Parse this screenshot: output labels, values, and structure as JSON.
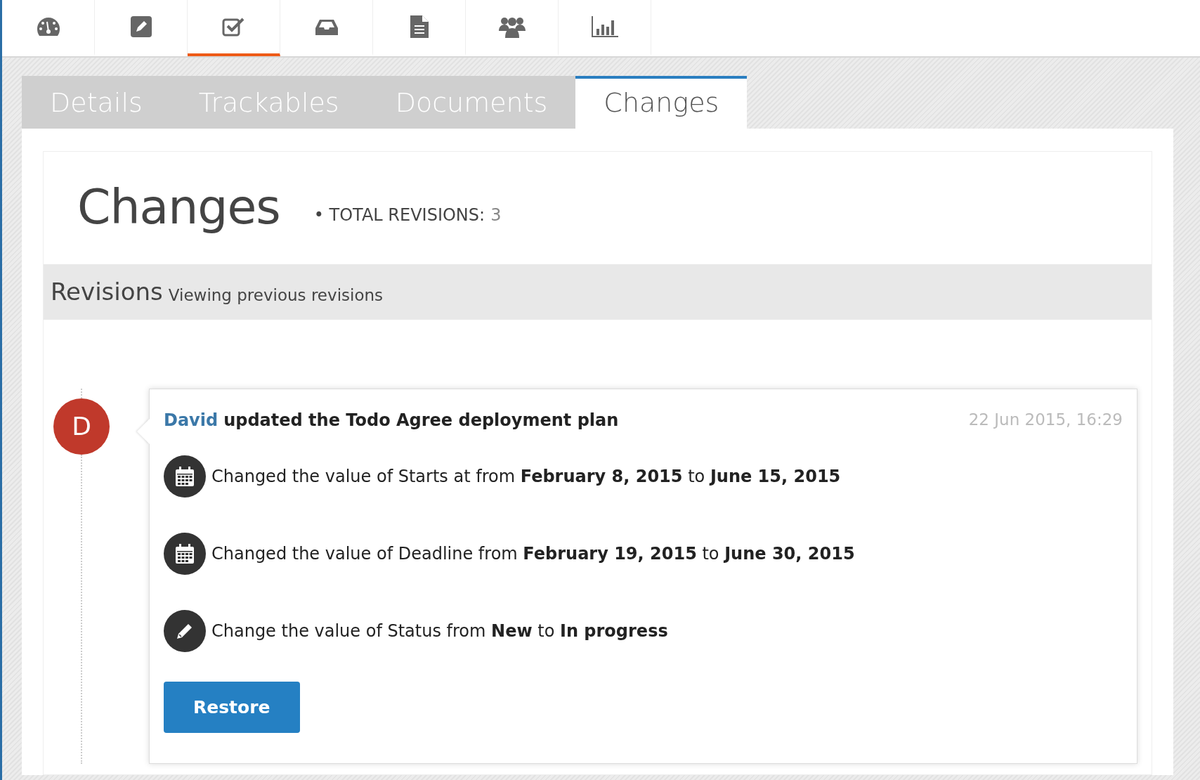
{
  "toolbar": [
    {
      "kind": "dashboard",
      "selected": false
    },
    {
      "kind": "edit",
      "selected": false
    },
    {
      "kind": "check",
      "selected": true
    },
    {
      "kind": "inbox",
      "selected": false
    },
    {
      "kind": "document",
      "selected": false
    },
    {
      "kind": "users",
      "selected": false
    },
    {
      "kind": "chart",
      "selected": false
    }
  ],
  "tabs": [
    {
      "label": "Details",
      "selected": false
    },
    {
      "label": "Trackables",
      "selected": false
    },
    {
      "label": "Documents",
      "selected": false
    },
    {
      "label": "Changes",
      "selected": true
    }
  ],
  "page_title": "Changes",
  "total": {
    "bullet": "•",
    "label": "TOTAL REVISIONS:",
    "count": "3"
  },
  "revisions_header": {
    "title": "Revisions",
    "subtitle": "Viewing previous revisions"
  },
  "revision": {
    "avatar": "D",
    "author": "David",
    "action": "updated the Todo Agree deployment plan",
    "time": "22 Jun 2015, 16:29",
    "changes": [
      {
        "kind": "date",
        "text": "Changed the value of Starts at from **February 8, 2015** to **June 15, 2015**"
      },
      {
        "kind": "date",
        "text": "Changed the value of Deadline from **February 19, 2015** to **June 30, 2015**"
      },
      {
        "kind": "edit",
        "text": "Change the value of Status from **New** to **In progress**"
      }
    ],
    "button": "Restore"
  }
}
